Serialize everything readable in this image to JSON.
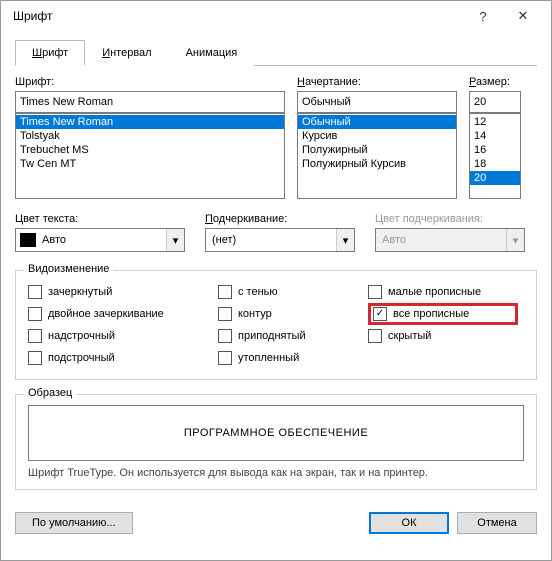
{
  "titlebar": {
    "title": "Шрифт"
  },
  "tabs": {
    "font": "Шрифт",
    "interval": "Интервал",
    "animation": "Анимация"
  },
  "labels": {
    "font": "Шрифт:",
    "style": "Начертание:",
    "size": "Размер:",
    "textcolor": "Цвет текста:",
    "underline": "Подчеркивание:",
    "underlinecolor": "Цвет подчеркивания:",
    "effects": "Видоизменение",
    "sample": "Образец"
  },
  "font": {
    "value": "Times New Roman",
    "items": [
      "Times New Roman",
      "Tolstyak",
      "Trebuchet MS",
      "Tw Cen MT"
    ],
    "selectedIndex": 0
  },
  "style": {
    "value": "Обычный",
    "items": [
      "Обычный",
      "Курсив",
      "Полужирный",
      "Полужирный Курсив"
    ],
    "selectedIndex": 0
  },
  "size": {
    "value": "20",
    "items": [
      "12",
      "14",
      "16",
      "18",
      "20"
    ],
    "selectedIndex": 4
  },
  "textcolor": {
    "value": "Авто"
  },
  "underline": {
    "value": "(нет)"
  },
  "underlinecolor": {
    "value": "Авто"
  },
  "effects": {
    "strike": "зачеркнутый",
    "dblstrike": "двойное зачеркивание",
    "superscript": "надстрочный",
    "subscript": "подстрочный",
    "shadow": "с тенью",
    "outline": "контур",
    "emboss": "приподнятый",
    "engrave": "утопленный",
    "smallcaps": "малые прописные",
    "allcaps": "все прописные",
    "hidden": "скрытый"
  },
  "checked": {
    "allcaps": true
  },
  "sample": {
    "text": "ПРОГРАММНОЕ ОБЕСПЕЧЕНИЕ"
  },
  "hint": "Шрифт TrueType. Он используется для вывода как на экран, так и на принтер.",
  "buttons": {
    "default": "По умолчанию...",
    "ok": "ОК",
    "cancel": "Отмена"
  }
}
